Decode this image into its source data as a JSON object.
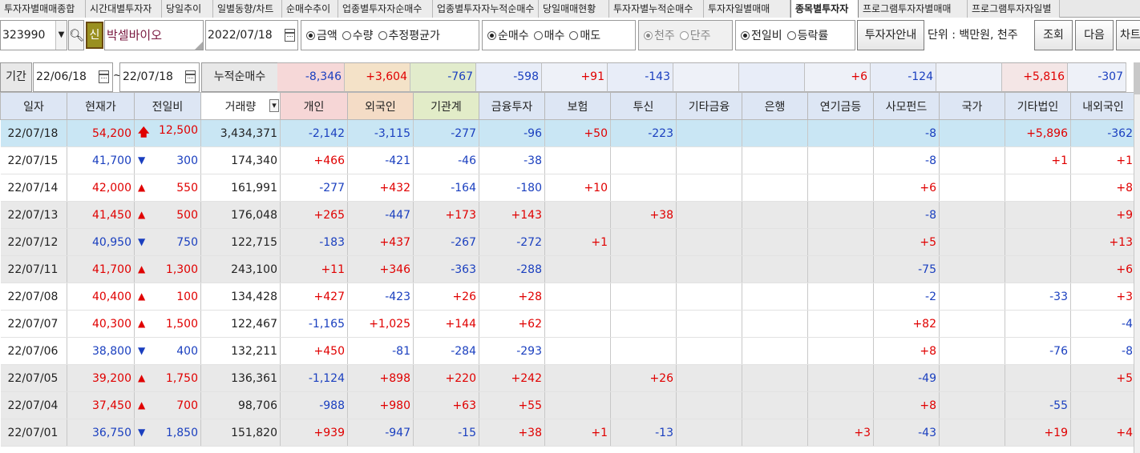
{
  "tabs": [
    {
      "label": "투자자별매매종합",
      "w": 107
    },
    {
      "label": "시간대별투자자",
      "w": 95
    },
    {
      "label": "당일추이",
      "w": 64
    },
    {
      "label": "일별동향/차트",
      "w": 86
    },
    {
      "label": "순매수추이",
      "w": 70
    },
    {
      "label": "업종별투자자순매수",
      "w": 118
    },
    {
      "label": "업종별투자자누적순매수",
      "w": 132
    },
    {
      "label": "당일매매현황",
      "w": 88
    },
    {
      "label": "투자자별누적순매수",
      "w": 118
    },
    {
      "label": "투자자일별매매",
      "w": 108
    },
    {
      "label": "종목별투자자",
      "w": 85,
      "active": true
    },
    {
      "label": "프로그램투자자별매매",
      "w": 136
    },
    {
      "label": "프로그램투자자일별",
      "w": 115
    }
  ],
  "controls": {
    "code": "323990",
    "new_label": "신",
    "stock_name": "박셀바이오",
    "date": "2022/07/18",
    "amount_group": [
      {
        "label": "금액",
        "on": true
      },
      {
        "label": "수량",
        "on": false
      },
      {
        "label": "추정평균가",
        "on": false
      }
    ],
    "trade_group": [
      {
        "label": "순매수",
        "on": true
      },
      {
        "label": "매수",
        "on": false
      },
      {
        "label": "매도",
        "on": false
      }
    ],
    "unit_group": [
      {
        "label": "천주",
        "on": true
      },
      {
        "label": "단주",
        "on": false
      }
    ],
    "compare_group": [
      {
        "label": "전일비",
        "on": true
      },
      {
        "label": "등락률",
        "on": false
      }
    ],
    "investor_info_btn": "투자자안내",
    "unit_text": "단위 : 백만원, 천주",
    "query_btn": "조회",
    "next_btn": "다음",
    "chart_btn": "차트"
  },
  "period": {
    "label": "기간",
    "from": "22/06/18",
    "tilde": "~",
    "to": "22/07/18",
    "cum_label": "누적순매수",
    "cum_values": [
      {
        "value": "-8,346",
        "bg": "#f6d8d8"
      },
      {
        "value": "+3,604",
        "bg": "#f4e2c8"
      },
      {
        "value": "-767",
        "bg": "#e2eccc"
      },
      {
        "value": "-598",
        "bg": "#e8edf8"
      },
      {
        "value": "+91",
        "bg": "#eef1f8"
      },
      {
        "value": "-143",
        "bg": "#e8edf8"
      },
      {
        "value": "",
        "bg": "#eef1f8"
      },
      {
        "value": "",
        "bg": "#e8edf8"
      },
      {
        "value": "+6",
        "bg": "#eef1f8"
      },
      {
        "value": "-124",
        "bg": "#e8edf8"
      },
      {
        "value": "",
        "bg": "#eef1f8"
      },
      {
        "value": "+5,816",
        "bg": "#f4e6e6"
      },
      {
        "value": "-307",
        "bg": "#eef1f8"
      }
    ]
  },
  "table": {
    "columns": [
      {
        "label": "일자",
        "bg": "#dde6f4"
      },
      {
        "label": "현재가",
        "bg": "#dde6f4"
      },
      {
        "label": "전일비",
        "bg": "#dde6f4"
      },
      {
        "label": "거래량",
        "bg": "#ffffff"
      },
      {
        "label": "개인",
        "bg": "#f6d6d6"
      },
      {
        "label": "외국인",
        "bg": "#f4dcc6"
      },
      {
        "label": "기관계",
        "bg": "#e2ecc8"
      },
      {
        "label": "금융투자",
        "bg": "#dde6f4"
      },
      {
        "label": "보험",
        "bg": "#dde6f4"
      },
      {
        "label": "투신",
        "bg": "#dde6f4"
      },
      {
        "label": "기타금융",
        "bg": "#dde6f4"
      },
      {
        "label": "은행",
        "bg": "#dde6f4"
      },
      {
        "label": "연기금등",
        "bg": "#dde6f4"
      },
      {
        "label": "사모펀드",
        "bg": "#dde6f4"
      },
      {
        "label": "국가",
        "bg": "#dde6f4"
      },
      {
        "label": "기타법인",
        "bg": "#dde6f4"
      },
      {
        "label": "내외국인",
        "bg": "#dde6f4"
      }
    ],
    "rows": [
      {
        "date": "22/07/18",
        "price": "54,200",
        "dir": "up-strong",
        "chg": "12,500",
        "vol": "3,434,371",
        "v": [
          "-2,142",
          "-3,115",
          "-277",
          "-96",
          "+50",
          "-223",
          "",
          "",
          "",
          "-8",
          "",
          "+5,896",
          "-362"
        ],
        "style": "sel"
      },
      {
        "date": "22/07/15",
        "price": "41,700",
        "dir": "down",
        "chg": "300",
        "vol": "174,340",
        "v": [
          "+466",
          "-421",
          "-46",
          "-38",
          "",
          "",
          "",
          "",
          "",
          "-8",
          "",
          "+1",
          "+1"
        ],
        "style": "white"
      },
      {
        "date": "22/07/14",
        "price": "42,000",
        "dir": "up",
        "chg": "550",
        "vol": "161,991",
        "v": [
          "-277",
          "+432",
          "-164",
          "-180",
          "+10",
          "",
          "",
          "",
          "",
          "+6",
          "",
          "",
          "+8"
        ],
        "style": "white"
      },
      {
        "date": "22/07/13",
        "price": "41,450",
        "dir": "up",
        "chg": "500",
        "vol": "176,048",
        "v": [
          "+265",
          "-447",
          "+173",
          "+143",
          "",
          "+38",
          "",
          "",
          "",
          "-8",
          "",
          "",
          "+9"
        ],
        "style": "gray"
      },
      {
        "date": "22/07/12",
        "price": "40,950",
        "dir": "down",
        "chg": "750",
        "vol": "122,715",
        "v": [
          "-183",
          "+437",
          "-267",
          "-272",
          "+1",
          "",
          "",
          "",
          "",
          "+5",
          "",
          "",
          "+13"
        ],
        "style": "gray"
      },
      {
        "date": "22/07/11",
        "price": "41,700",
        "dir": "up",
        "chg": "1,300",
        "vol": "243,100",
        "v": [
          "+11",
          "+346",
          "-363",
          "-288",
          "",
          "",
          "",
          "",
          "",
          "-75",
          "",
          "",
          "+6"
        ],
        "style": "gray"
      },
      {
        "date": "22/07/08",
        "price": "40,400",
        "dir": "up",
        "chg": "100",
        "vol": "134,428",
        "v": [
          "+427",
          "-423",
          "+26",
          "+28",
          "",
          "",
          "",
          "",
          "",
          "-2",
          "",
          "-33",
          "+3"
        ],
        "style": "white"
      },
      {
        "date": "22/07/07",
        "price": "40,300",
        "dir": "up",
        "chg": "1,500",
        "vol": "122,467",
        "v": [
          "-1,165",
          "+1,025",
          "+144",
          "+62",
          "",
          "",
          "",
          "",
          "",
          "+82",
          "",
          "",
          "-4"
        ],
        "style": "white"
      },
      {
        "date": "22/07/06",
        "price": "38,800",
        "dir": "down",
        "chg": "400",
        "vol": "132,211",
        "v": [
          "+450",
          "-81",
          "-284",
          "-293",
          "",
          "",
          "",
          "",
          "",
          "+8",
          "",
          "-76",
          "-8"
        ],
        "style": "white"
      },
      {
        "date": "22/07/05",
        "price": "39,200",
        "dir": "up",
        "chg": "1,750",
        "vol": "136,361",
        "v": [
          "-1,124",
          "+898",
          "+220",
          "+242",
          "",
          "+26",
          "",
          "",
          "",
          "-49",
          "",
          "",
          "+5"
        ],
        "style": "gray"
      },
      {
        "date": "22/07/04",
        "price": "37,450",
        "dir": "up",
        "chg": "700",
        "vol": "98,706",
        "v": [
          "-988",
          "+980",
          "+63",
          "+55",
          "",
          "",
          "",
          "",
          "",
          "+8",
          "",
          "-55",
          ""
        ],
        "style": "gray"
      },
      {
        "date": "22/07/01",
        "price": "36,750",
        "dir": "down",
        "chg": "1,850",
        "vol": "151,820",
        "v": [
          "+939",
          "-947",
          "-15",
          "+38",
          "+1",
          "-13",
          "",
          "",
          "+3",
          "-43",
          "",
          "+19",
          "+4"
        ],
        "style": "gray"
      }
    ]
  }
}
